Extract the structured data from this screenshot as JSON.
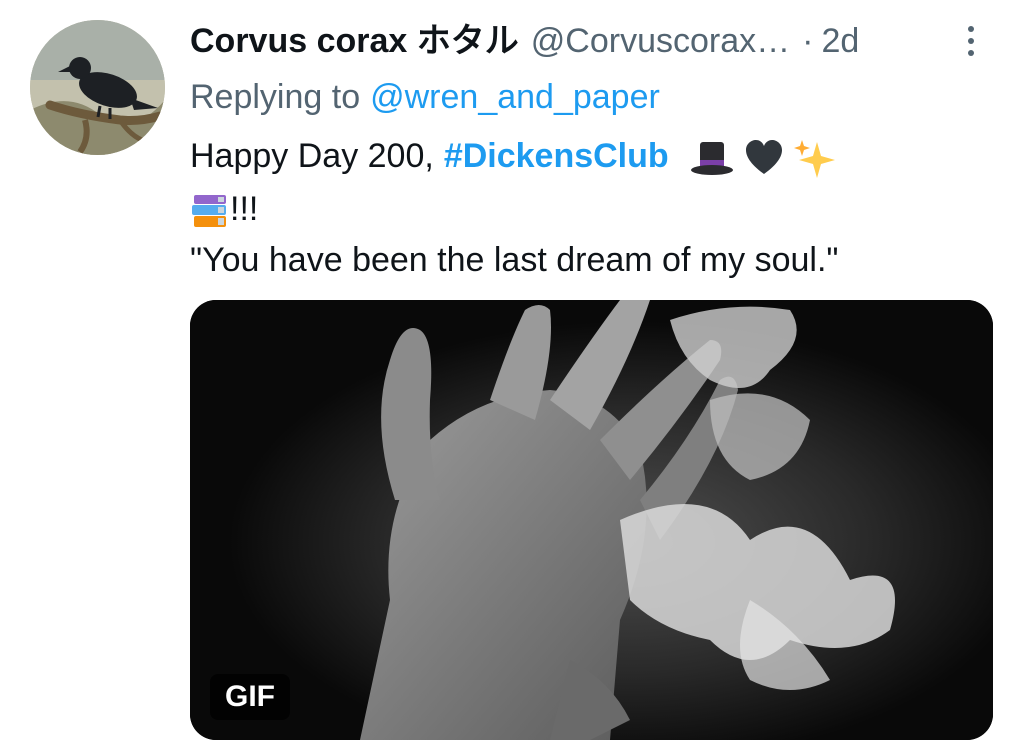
{
  "tweet": {
    "display_name": "Corvus corax ホタル",
    "handle": "@Corvuscorax…",
    "separator": "·",
    "time": "2d",
    "replying_label": "Replying to",
    "replying_to": "@wren_and_paper",
    "text_line1": "Happy Day 200,",
    "hashtag": "#DickensClub",
    "text_line2_suffix": "!!!",
    "quote": "\"You have been the last dream of my soul.\"",
    "emojis": [
      "top-hat-icon",
      "black-heart-icon",
      "sparkles-icon",
      "books-icon"
    ]
  },
  "media": {
    "badge": "GIF",
    "description_icon": "burning-hand-image"
  },
  "colors": {
    "link": "#1d9bf0",
    "secondary": "#536471",
    "text": "#0f1419"
  }
}
